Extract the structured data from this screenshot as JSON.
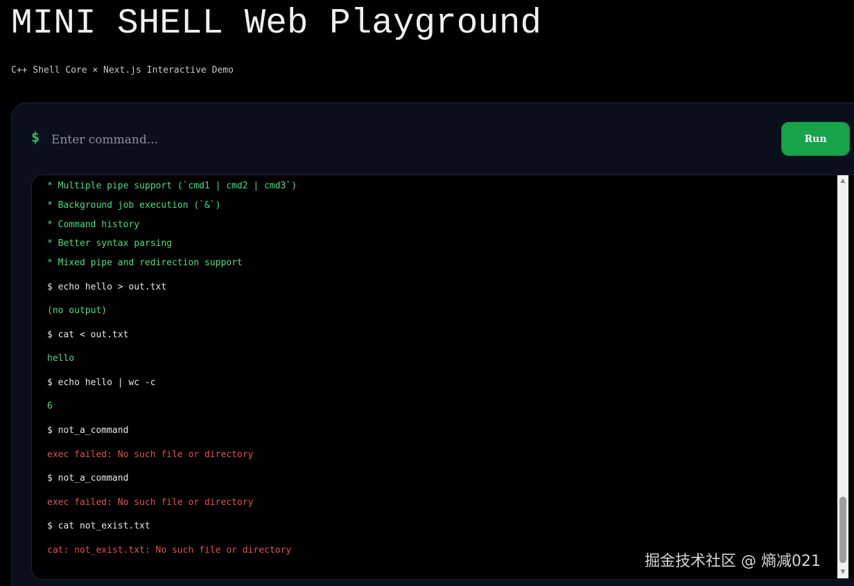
{
  "header": {
    "title": "MINI SHELL Web Playground",
    "subtitle": "C++ Shell Core × Next.js Interactive Demo"
  },
  "command_bar": {
    "prompt_symbol": "$",
    "placeholder": "Enter command...",
    "value": "",
    "run_label": "Run"
  },
  "terminal": {
    "lines": [
      {
        "kind": "info",
        "text": "* Multiple pipe support (`cmd1 | cmd2 | cmd3`)"
      },
      {
        "kind": "info",
        "text": "* Background job execution (`&`)"
      },
      {
        "kind": "info",
        "text": "* Command history"
      },
      {
        "kind": "info",
        "text": "* Better syntax parsing"
      },
      {
        "kind": "info",
        "text": "* Mixed pipe and redirection support"
      },
      {
        "kind": "cmd",
        "text": "$ echo hello > out.txt"
      },
      {
        "kind": "out",
        "text": "(no output)"
      },
      {
        "kind": "cmd",
        "text": "$ cat < out.txt"
      },
      {
        "kind": "out",
        "text": "hello"
      },
      {
        "kind": "cmd",
        "text": "$ echo hello | wc -c"
      },
      {
        "kind": "out",
        "text": "6"
      },
      {
        "kind": "cmd",
        "text": "$ not_a_command"
      },
      {
        "kind": "err",
        "text": "exec failed: No such file or directory"
      },
      {
        "kind": "cmd",
        "text": "$ not_a_command"
      },
      {
        "kind": "err",
        "text": "exec failed: No such file or directory"
      },
      {
        "kind": "cmd",
        "text": "$ cat not_exist.txt"
      },
      {
        "kind": "err",
        "text": "cat: not_exist.txt: No such file or directory"
      }
    ]
  },
  "scrollbar": {
    "up_icon": "triangle-up",
    "down_icon": "triangle-down",
    "position_fraction": 0.95
  },
  "watermark": "掘金技术社区 @ 熵减021",
  "colors": {
    "background": "#000000",
    "panel": "#0a0f1c",
    "accent": "#16a34a",
    "prompt": "#22c55e",
    "output": "#4ade80",
    "error": "#e05252",
    "command": "#e8e8e8"
  }
}
